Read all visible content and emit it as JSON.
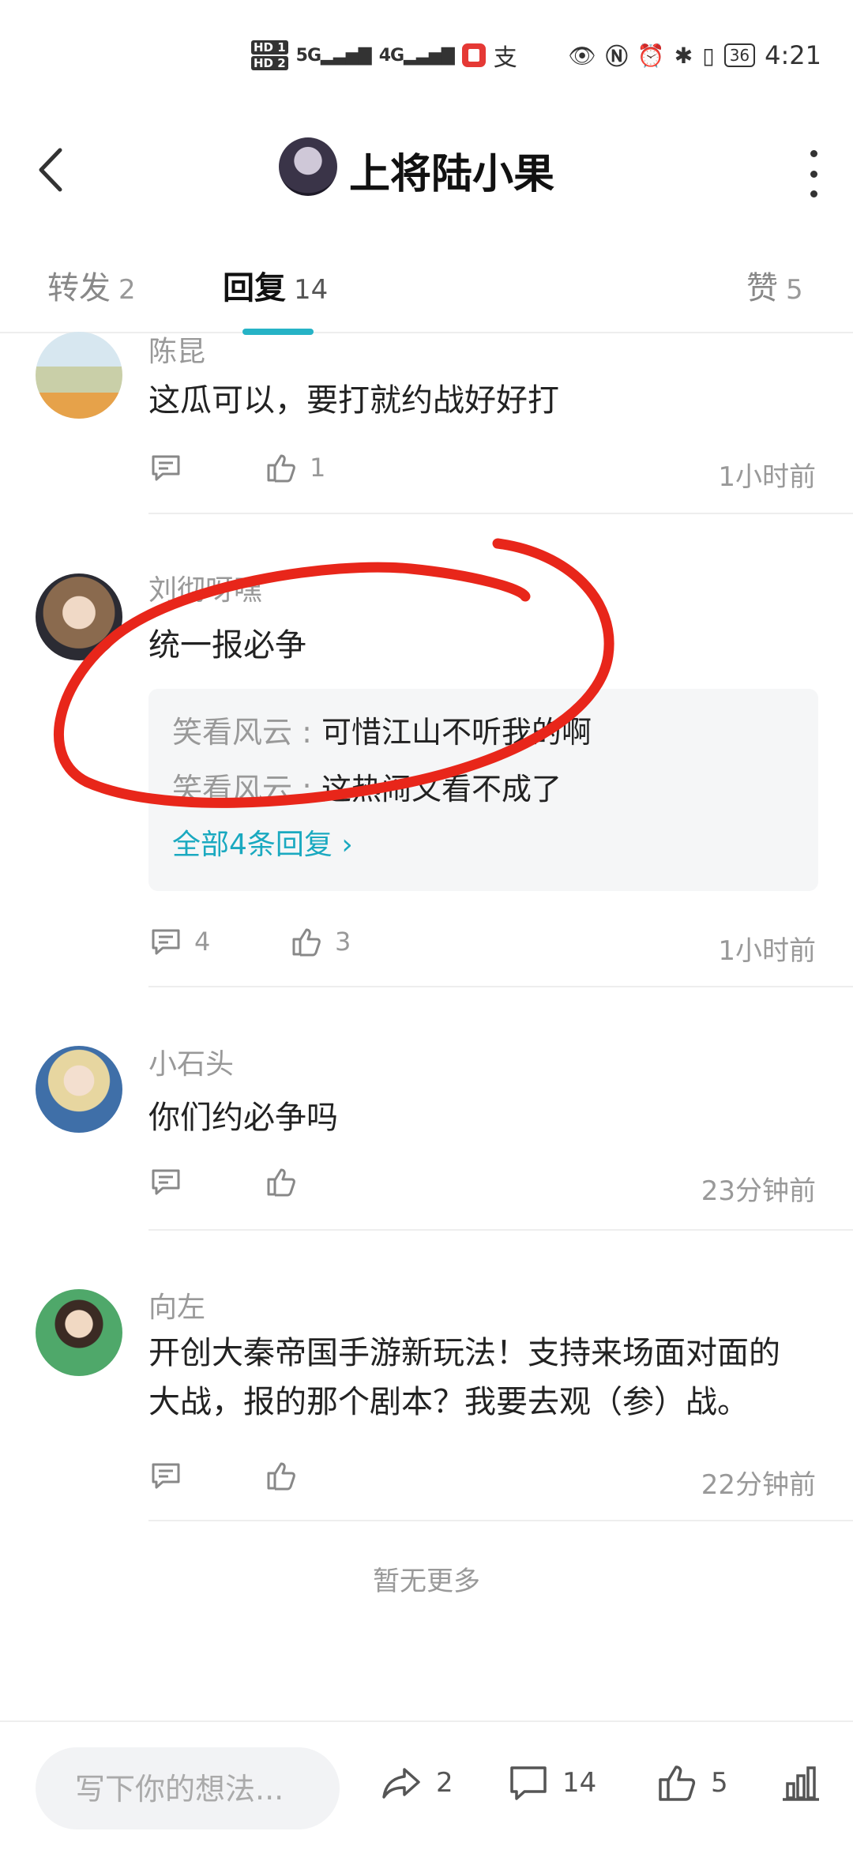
{
  "status_bar": {
    "sim1": "HD 1",
    "sim2": "HD 2",
    "network1": "5G",
    "network2": "4G",
    "alipay_glyph": "支",
    "battery": "36",
    "time": "4:21"
  },
  "header": {
    "title": "上将陆小果"
  },
  "tabs": [
    {
      "label": "转发",
      "count": "2"
    },
    {
      "label": "回复",
      "count": "14"
    },
    {
      "label": "赞",
      "count": "5"
    }
  ],
  "comments": [
    {
      "user": "陈昆",
      "text": "这瓜可以，要打就约战好好打",
      "reply_count": "",
      "like_count": "1",
      "time": "1小时前"
    },
    {
      "user": "刘彻呀嘿",
      "text": "统一报必争",
      "replies": [
        {
          "who": "笑看风云",
          "text": "可惜江山不听我的啊"
        },
        {
          "who": "笑看风云",
          "text": "这热闹又看不成了"
        }
      ],
      "more_replies": "全部4条回复",
      "reply_count": "4",
      "like_count": "3",
      "time": "1小时前"
    },
    {
      "user": "小石头",
      "text": "你们约必争吗",
      "reply_count": "",
      "like_count": "",
      "time": "23分钟前"
    },
    {
      "user": "向左",
      "text_line1": "开创大秦帝国手游新玩法！支持来场面对面的",
      "text_line2": "大战，报的那个剧本？我要去观（参）战。",
      "reply_count": "",
      "like_count": "",
      "time": "22分钟前"
    }
  ],
  "no_more": "暂无更多",
  "bottom_bar": {
    "input_placeholder": "写下你的想法...",
    "repost_count": "2",
    "comment_count": "14",
    "like_count": "5"
  },
  "colors": {
    "accent": "#26b3c6",
    "link": "#1aa9c0",
    "annotation": "#e8261a"
  }
}
